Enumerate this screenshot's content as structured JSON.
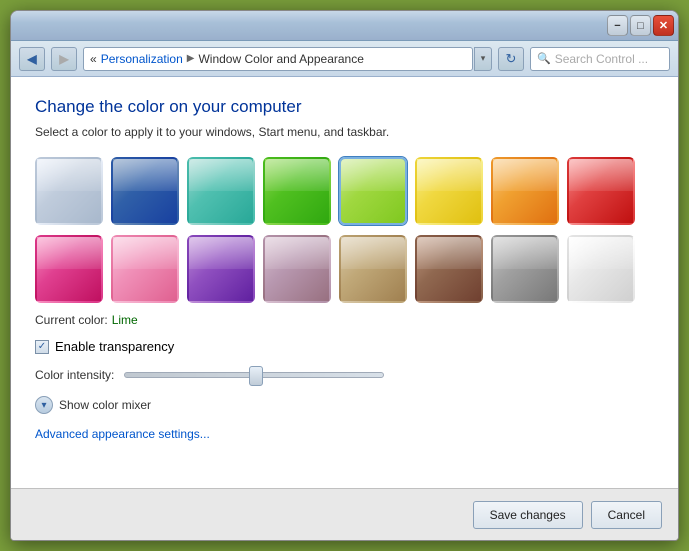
{
  "window": {
    "title": "Window Color and Appearance"
  },
  "titlebar": {
    "minimize_label": "−",
    "maximize_label": "□",
    "close_label": "✕"
  },
  "addressbar": {
    "back_label": "◀",
    "forward_label": "▶",
    "breadcrumb_prefix": "«",
    "breadcrumb_root": "Personalization",
    "breadcrumb_arrow": "▶",
    "breadcrumb_current": "Window Color and Appearance",
    "refresh_label": "↻",
    "search_placeholder": "Search Control ...",
    "search_icon_label": "🔍"
  },
  "content": {
    "page_title": "Change the color on your computer",
    "subtitle": "Select a color to apply it to your windows, Start menu, and taskbar.",
    "current_color_label": "Current color:",
    "current_color_value": "Lime",
    "transparency_label": "Enable transparency",
    "intensity_label": "Color intensity:",
    "color_mixer_label": "Show color mixer",
    "advanced_link": "Advanced appearance settings...",
    "colors_row1": [
      {
        "id": "default",
        "class": "sw-default",
        "name": "Default"
      },
      {
        "id": "blue-dark",
        "class": "sw-blue-dark",
        "name": "Dark Blue"
      },
      {
        "id": "teal",
        "class": "sw-teal",
        "name": "Teal"
      },
      {
        "id": "green",
        "class": "sw-green",
        "name": "Green"
      },
      {
        "id": "lime",
        "class": "sw-lime",
        "name": "Lime",
        "selected": true
      },
      {
        "id": "yellow",
        "class": "sw-yellow",
        "name": "Yellow"
      },
      {
        "id": "orange",
        "class": "sw-orange",
        "name": "Orange"
      },
      {
        "id": "red",
        "class": "sw-red",
        "name": "Red"
      }
    ],
    "colors_row2": [
      {
        "id": "pink",
        "class": "sw-pink",
        "name": "Pink"
      },
      {
        "id": "rose",
        "class": "sw-rose",
        "name": "Rose"
      },
      {
        "id": "purple",
        "class": "sw-purple",
        "name": "Purple"
      },
      {
        "id": "mauve",
        "class": "sw-mauve",
        "name": "Mauve"
      },
      {
        "id": "tan",
        "class": "sw-tan",
        "name": "Tan"
      },
      {
        "id": "brown",
        "class": "sw-brown",
        "name": "Brown"
      },
      {
        "id": "gray",
        "class": "sw-gray",
        "name": "Gray"
      },
      {
        "id": "white",
        "class": "sw-white",
        "name": "White"
      }
    ]
  },
  "footer": {
    "save_label": "Save changes",
    "cancel_label": "Cancel"
  }
}
